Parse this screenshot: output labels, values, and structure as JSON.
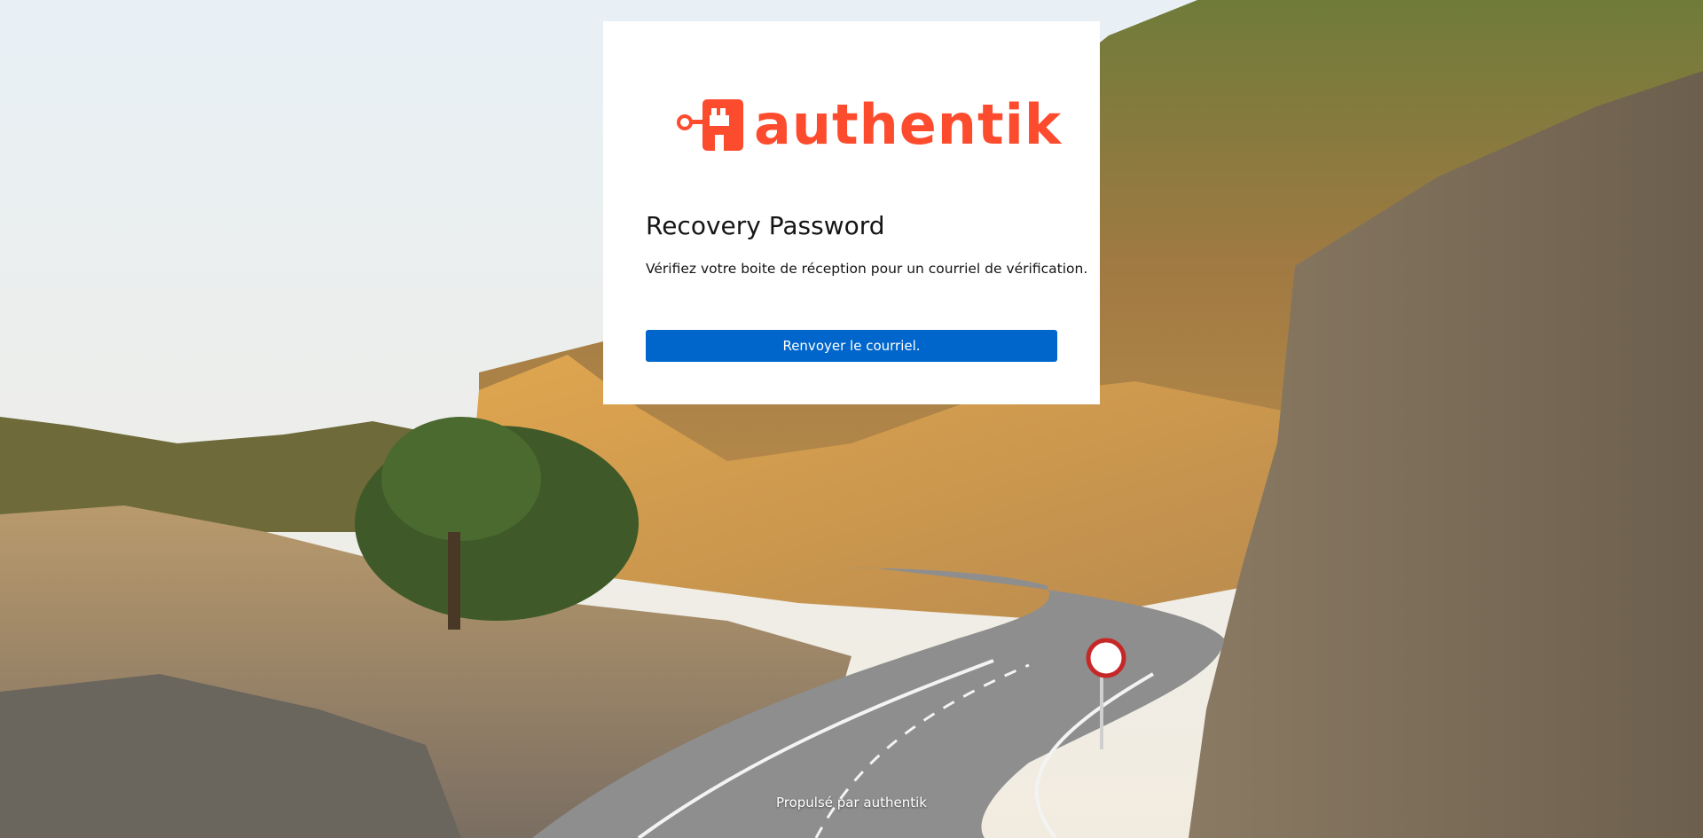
{
  "background": {
    "image": "winding-mountain-road-landscape"
  },
  "brand": {
    "logo_icon": "authentik-logo-icon",
    "name": "authentik",
    "color": "#fd4b2d"
  },
  "card": {
    "title": "Recovery Password",
    "message": "Vérifiez votre boite de réception pour un courriel de vérification.",
    "resend_button_label": "Renvoyer le courriel."
  },
  "footer": {
    "powered_by": "Propulsé par authentik"
  },
  "colors": {
    "primary_button": "#0066cc",
    "card_background": "#ffffff"
  }
}
